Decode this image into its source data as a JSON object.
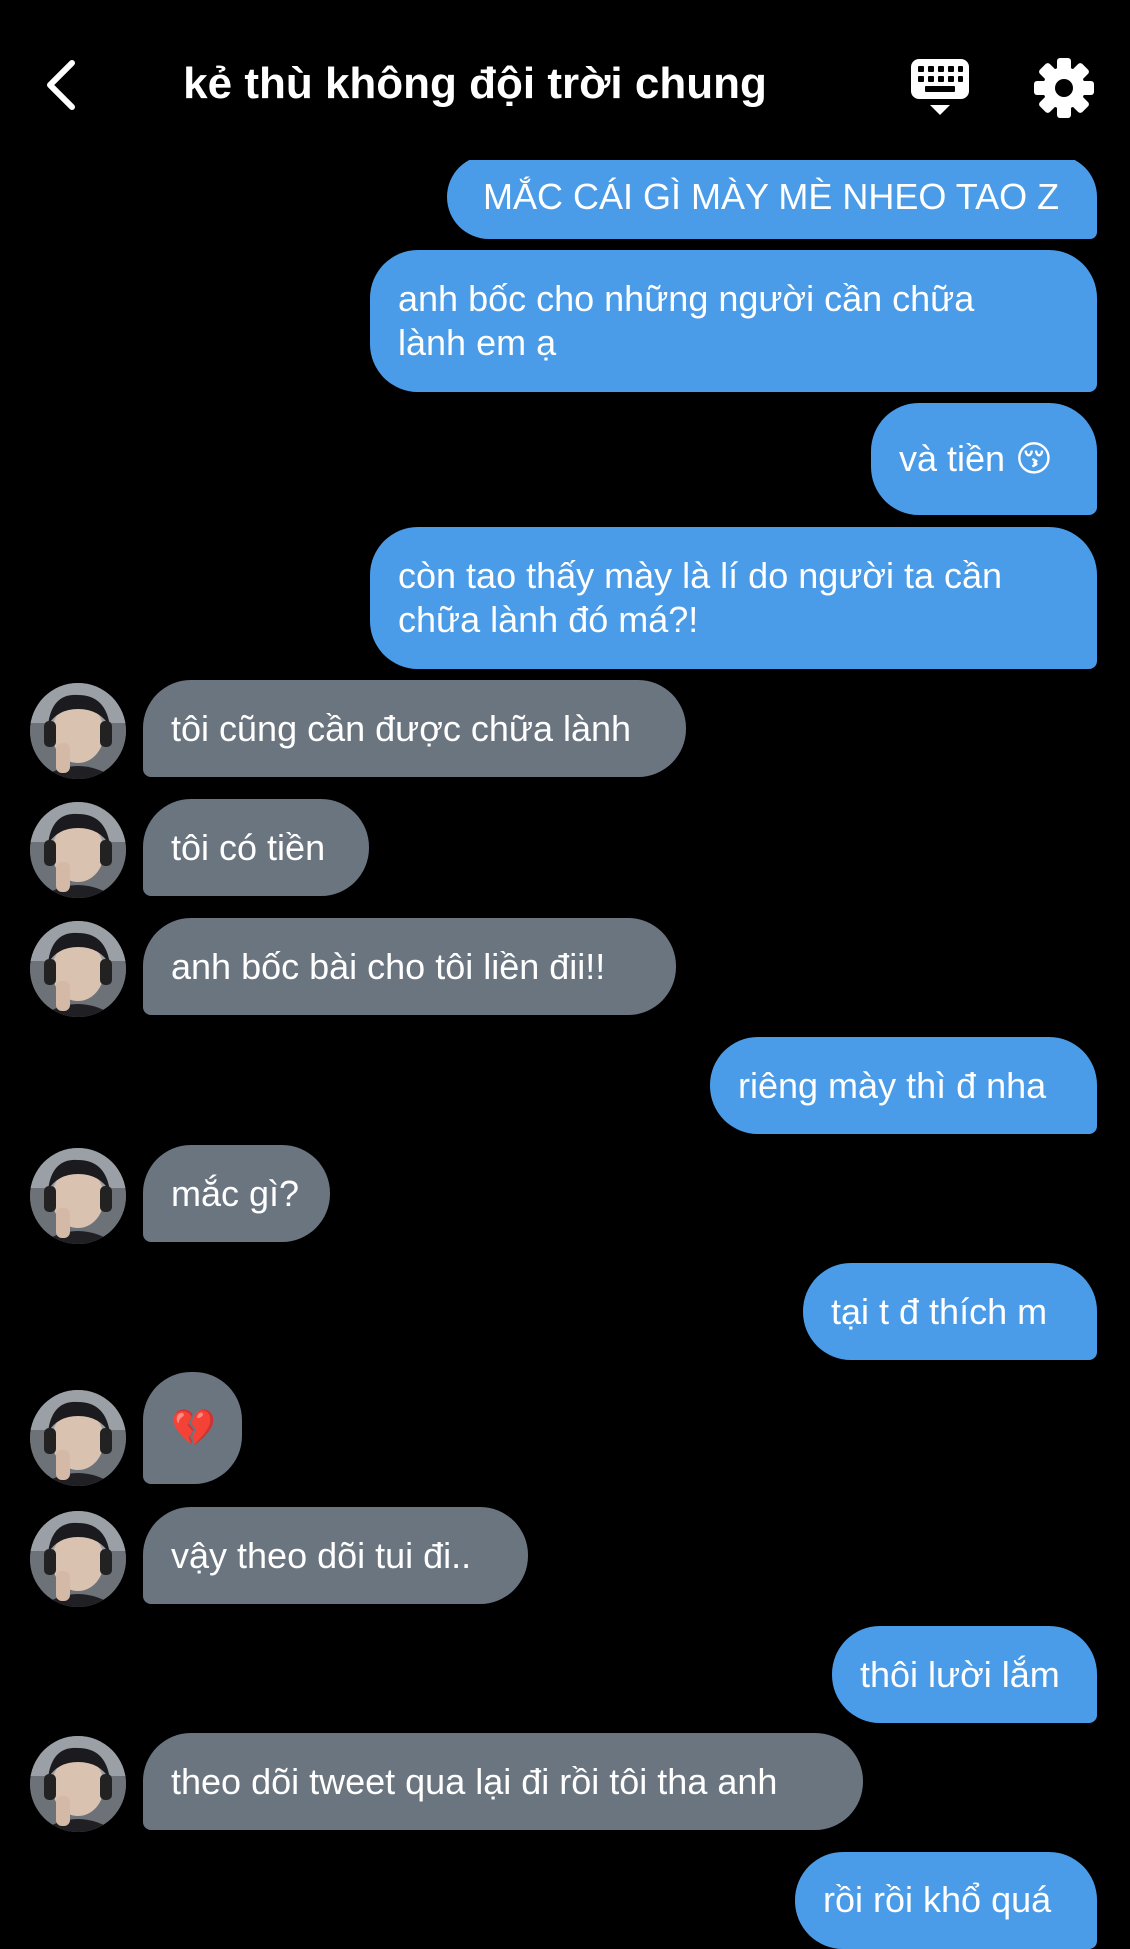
{
  "header": {
    "title": "kẻ thù không đội trời chung",
    "back_icon": "chevron-left-icon",
    "keyboard_icon": "keyboard-icon",
    "settings_icon": "gear-icon"
  },
  "colors": {
    "background": "#000000",
    "sent_bubble": "#4a9be8",
    "received_bubble": "#6b7580",
    "text": "#ffffff"
  },
  "messages": [
    {
      "from": "me",
      "text": "MẮC CÁI GÌ MÀY MÈ NHEO TAO Z"
    },
    {
      "from": "me",
      "text": "anh bốc cho những người cần chữa lành em ạ"
    },
    {
      "from": "me",
      "text": "và tiền 😚"
    },
    {
      "from": "me",
      "text": "còn tao thấy mày là lí do người ta cần chữa lành đó má?!"
    },
    {
      "from": "them",
      "text": "tôi cũng cần được chữa lành"
    },
    {
      "from": "them",
      "text": "tôi có tiền"
    },
    {
      "from": "them",
      "text": "anh bốc bài cho tôi liền đii!!"
    },
    {
      "from": "me",
      "text": "riêng mày thì đ nha"
    },
    {
      "from": "them",
      "text": "mắc gì?"
    },
    {
      "from": "me",
      "text": "tại t đ thích m"
    },
    {
      "from": "them",
      "text": "💔"
    },
    {
      "from": "them",
      "text": "vậy theo dõi tui đi.."
    },
    {
      "from": "me",
      "text": "thôi lười lắm"
    },
    {
      "from": "them",
      "text": "theo dõi tweet qua lại đi rồi tôi tha anh"
    },
    {
      "from": "me",
      "text": "rồi rồi khổ quá"
    }
  ]
}
